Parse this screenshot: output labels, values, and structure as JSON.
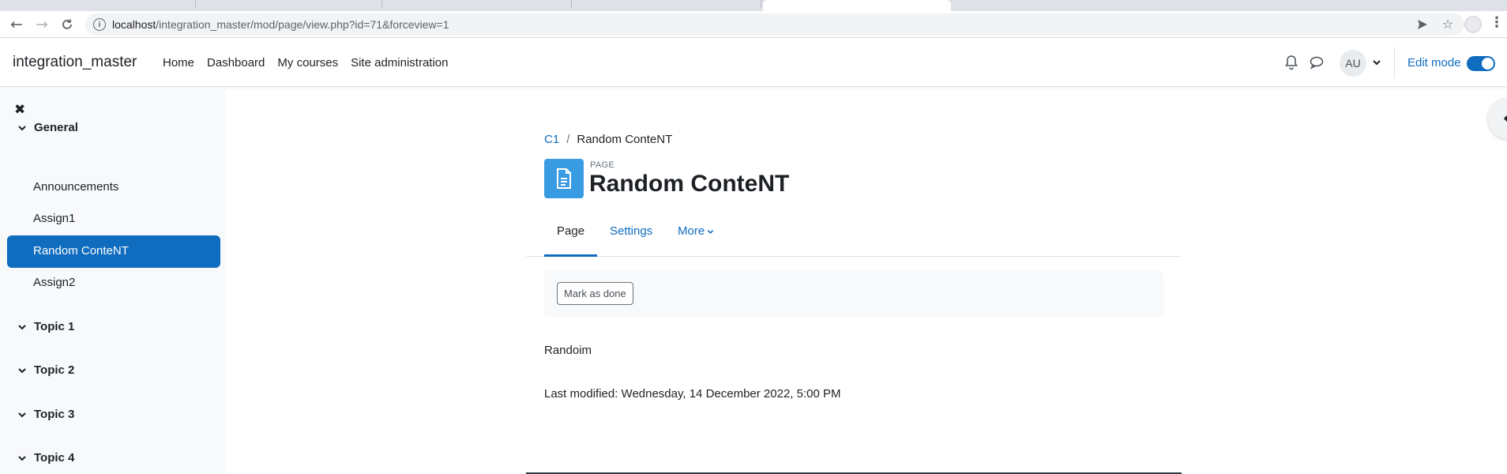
{
  "browser": {
    "url_host": "localhost",
    "url_path": "/integration_master/mod/page/view.php?id=71&forceview=1"
  },
  "navbar": {
    "brand": "integration_master",
    "items": [
      "Home",
      "Dashboard",
      "My courses",
      "Site administration"
    ],
    "avatar_initials": "AU",
    "edit_mode_label": "Edit mode",
    "edit_mode_on": true
  },
  "course_index": {
    "sections": [
      {
        "title": "General",
        "items": [
          "Announcements",
          "Assign1",
          "Random ConteNT",
          "Assign2"
        ]
      },
      {
        "title": "Topic 1"
      },
      {
        "title": "Topic 2"
      },
      {
        "title": "Topic 3"
      },
      {
        "title": "Topic 4"
      }
    ],
    "active_item": "Random ConteNT"
  },
  "breadcrumb": {
    "course": "C1",
    "current": "Random ConteNT"
  },
  "page": {
    "module_type": "PAGE",
    "title": "Random ConteNT",
    "tabs": [
      "Page",
      "Settings",
      "More"
    ],
    "active_tab": "Page",
    "mark_done_label": "Mark as done",
    "content": "Randoim",
    "last_modified": "Last modified: Wednesday, 14 December 2022, 5:00 PM"
  },
  "colors": {
    "primary": "#0f6cbf",
    "activity_icon_bg": "#399be2",
    "drawer_bg": "#f8f9fa"
  }
}
